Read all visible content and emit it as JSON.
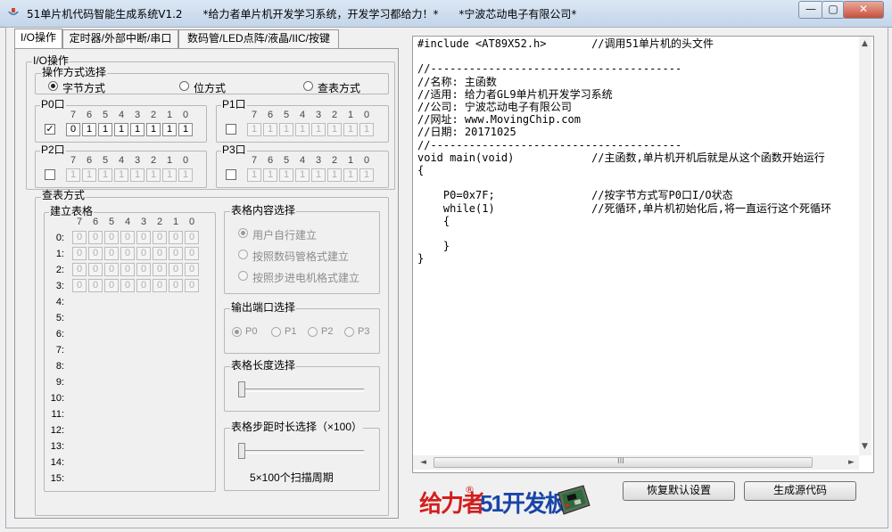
{
  "window": {
    "title": "51单片机代码智能生成系统V1.2      *给力者单片机开发学习系统，开发学习都给力！*      *宁波芯动电子有限公司*",
    "min_glyph": "—",
    "max_glyph": "▢",
    "close_glyph": "✕"
  },
  "tabs": [
    {
      "label": "I/O操作",
      "active": true
    },
    {
      "label": "定时器/外部中断/串口",
      "active": false
    },
    {
      "label": "数码管/LED点阵/液晶/IIC/按键",
      "active": false
    }
  ],
  "io": {
    "group_title": "I/O操作",
    "mode_group_title": "操作方式选择",
    "modes": [
      {
        "label": "字节方式",
        "selected": true
      },
      {
        "label": "位方式",
        "selected": false
      },
      {
        "label": "查表方式",
        "selected": false
      }
    ],
    "bit_header": [
      "7",
      "6",
      "5",
      "4",
      "3",
      "2",
      "1",
      "0"
    ],
    "ports": [
      {
        "name": "P0口",
        "checked": true,
        "check_glyph": "✓",
        "bits": [
          "0",
          "1",
          "1",
          "1",
          "1",
          "1",
          "1",
          "1"
        ]
      },
      {
        "name": "P1口",
        "checked": false,
        "check_glyph": "",
        "bits": [
          "1",
          "1",
          "1",
          "1",
          "1",
          "1",
          "1",
          "1"
        ]
      },
      {
        "name": "P2口",
        "checked": false,
        "check_glyph": "",
        "bits": [
          "1",
          "1",
          "1",
          "1",
          "1",
          "1",
          "1",
          "1"
        ]
      },
      {
        "name": "P3口",
        "checked": false,
        "check_glyph": "",
        "bits": [
          "1",
          "1",
          "1",
          "1",
          "1",
          "1",
          "1",
          "1"
        ]
      }
    ]
  },
  "lookup": {
    "group_title": "查表方式",
    "build_table_title": "建立表格",
    "row_labels": [
      "0:",
      "1:",
      "2:",
      "3:",
      "4:",
      "5:",
      "6:",
      "7:",
      "8:",
      "9:",
      "10:",
      "11:",
      "12:",
      "13:",
      "14:",
      "15:"
    ],
    "rows": [
      [
        "0",
        "0",
        "0",
        "0",
        "0",
        "0",
        "0",
        "0"
      ],
      [
        "0",
        "0",
        "0",
        "0",
        "0",
        "0",
        "0",
        "0"
      ],
      [
        "0",
        "0",
        "0",
        "0",
        "0",
        "0",
        "0",
        "0"
      ],
      [
        "0",
        "0",
        "0",
        "0",
        "0",
        "0",
        "0",
        "0"
      ]
    ],
    "content_group_title": "表格内容选择",
    "content_options": [
      {
        "label": "用户自行建立",
        "selected": true
      },
      {
        "label": "按照数码管格式建立",
        "selected": false
      },
      {
        "label": "按照步进电机格式建立",
        "selected": false
      }
    ],
    "port_group_title": "输出端口选择",
    "port_options": [
      {
        "label": "P0",
        "selected": true
      },
      {
        "label": "P1",
        "selected": false
      },
      {
        "label": "P2",
        "selected": false
      },
      {
        "label": "P3",
        "selected": false
      }
    ],
    "length_group_title": "表格长度选择",
    "length_value": 0,
    "step_group_title": "表格步距时长选择（×100）",
    "step_value": 0,
    "step_caption": "5×100个扫描周期"
  },
  "code": {
    "lines": [
      "#include <AT89X52.h>       //调用51单片机的头文件",
      "",
      "//---------------------------------------",
      "//名称: 主函数",
      "//适用: 给力者GL9单片机开发学习系统",
      "//公司: 宁波芯动电子有限公司",
      "//网址: www.MovingChip.com",
      "//日期: 20171025",
      "//---------------------------------------",
      "void main(void)            //主函数,单片机开机后就是从这个函数开始运行",
      "{",
      "",
      "    P0=0x7F;               //按字节方式写P0口I/O状态",
      "    while(1)               //死循环,单片机初始化后,将一直运行这个死循环",
      "    {",
      "",
      "    }",
      "}"
    ]
  },
  "buttons": {
    "restore_defaults": "恢复默认设置",
    "generate_code": "生成源代码"
  },
  "logo": {
    "brand_text": "给力者",
    "registered": "®",
    "board_text": "51开发板",
    "icon": "dev-board-photo"
  },
  "scrollbars": {
    "up_arrow": "▲",
    "down_arrow": "▼",
    "left_arrow": "◄",
    "right_arrow": "►",
    "grip": "III"
  }
}
